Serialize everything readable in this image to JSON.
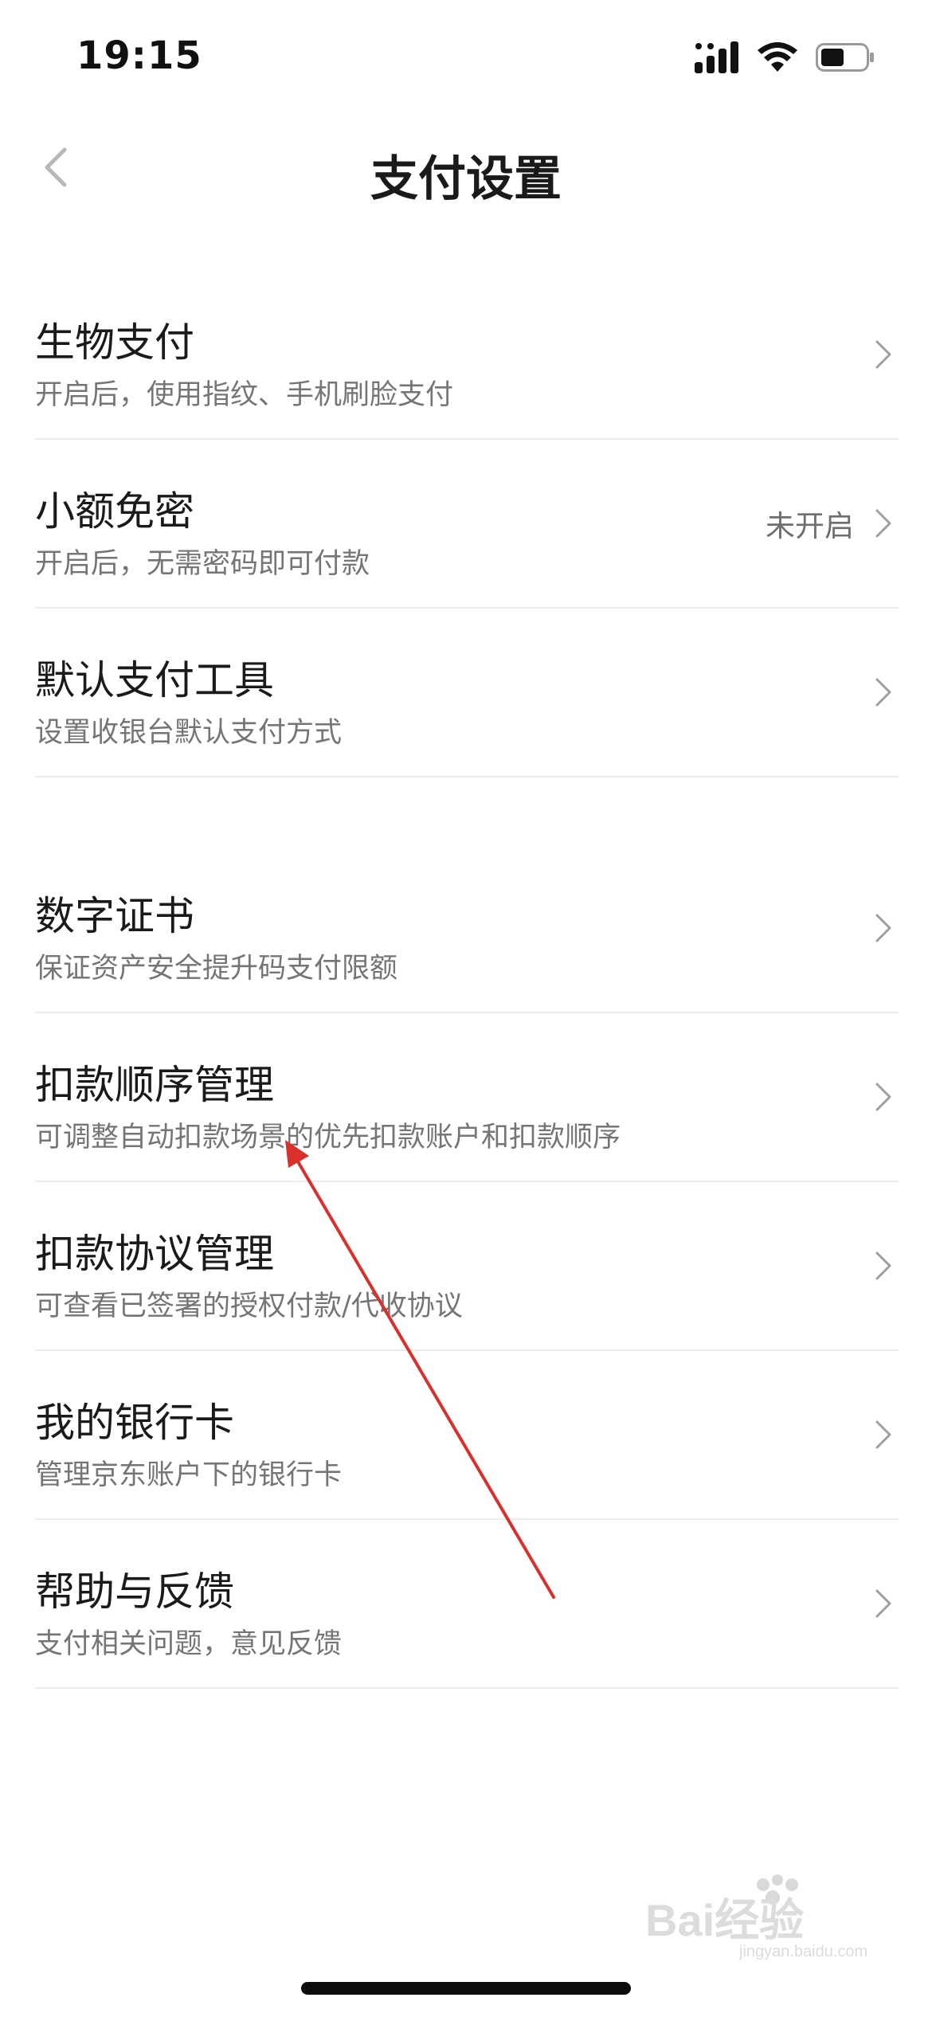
{
  "status_bar": {
    "time": "19:15",
    "icons": [
      "signal-icon",
      "wifi-icon",
      "battery-icon"
    ]
  },
  "nav": {
    "back_icon": "chevron-left-icon",
    "title": "支付设置"
  },
  "groups": [
    {
      "items": [
        {
          "title": "生物支付",
          "subtitle": "开启后，使用指纹、手机刷脸支付",
          "status": ""
        },
        {
          "title": "小额免密",
          "subtitle": "开启后，无需密码即可付款",
          "status": "未开启"
        },
        {
          "title": "默认支付工具",
          "subtitle": "设置收银台默认支付方式",
          "status": ""
        }
      ]
    },
    {
      "items": [
        {
          "title": "数字证书",
          "subtitle": "保证资产安全提升码支付限额",
          "status": ""
        },
        {
          "title": "扣款顺序管理",
          "subtitle": "可调整自动扣款场景的优先扣款账户和扣款顺序",
          "status": ""
        },
        {
          "title": "扣款协议管理",
          "subtitle": "可查看已签署的授权付款/代收协议",
          "status": ""
        },
        {
          "title": "我的银行卡",
          "subtitle": "管理京东账户下的银行卡",
          "status": ""
        },
        {
          "title": "帮助与反馈",
          "subtitle": "支付相关问题，意见反馈",
          "status": ""
        }
      ]
    }
  ],
  "colors": {
    "background": "#ffffff",
    "title_text": "#1a1a1a",
    "subtitle_text": "#757575",
    "divider": "#ececec",
    "annotation_arrow": "#d9302c",
    "watermark": "#d8d8d8"
  },
  "watermark": {
    "text": "Bai经验",
    "sub": "jingyan.baidu.com"
  }
}
